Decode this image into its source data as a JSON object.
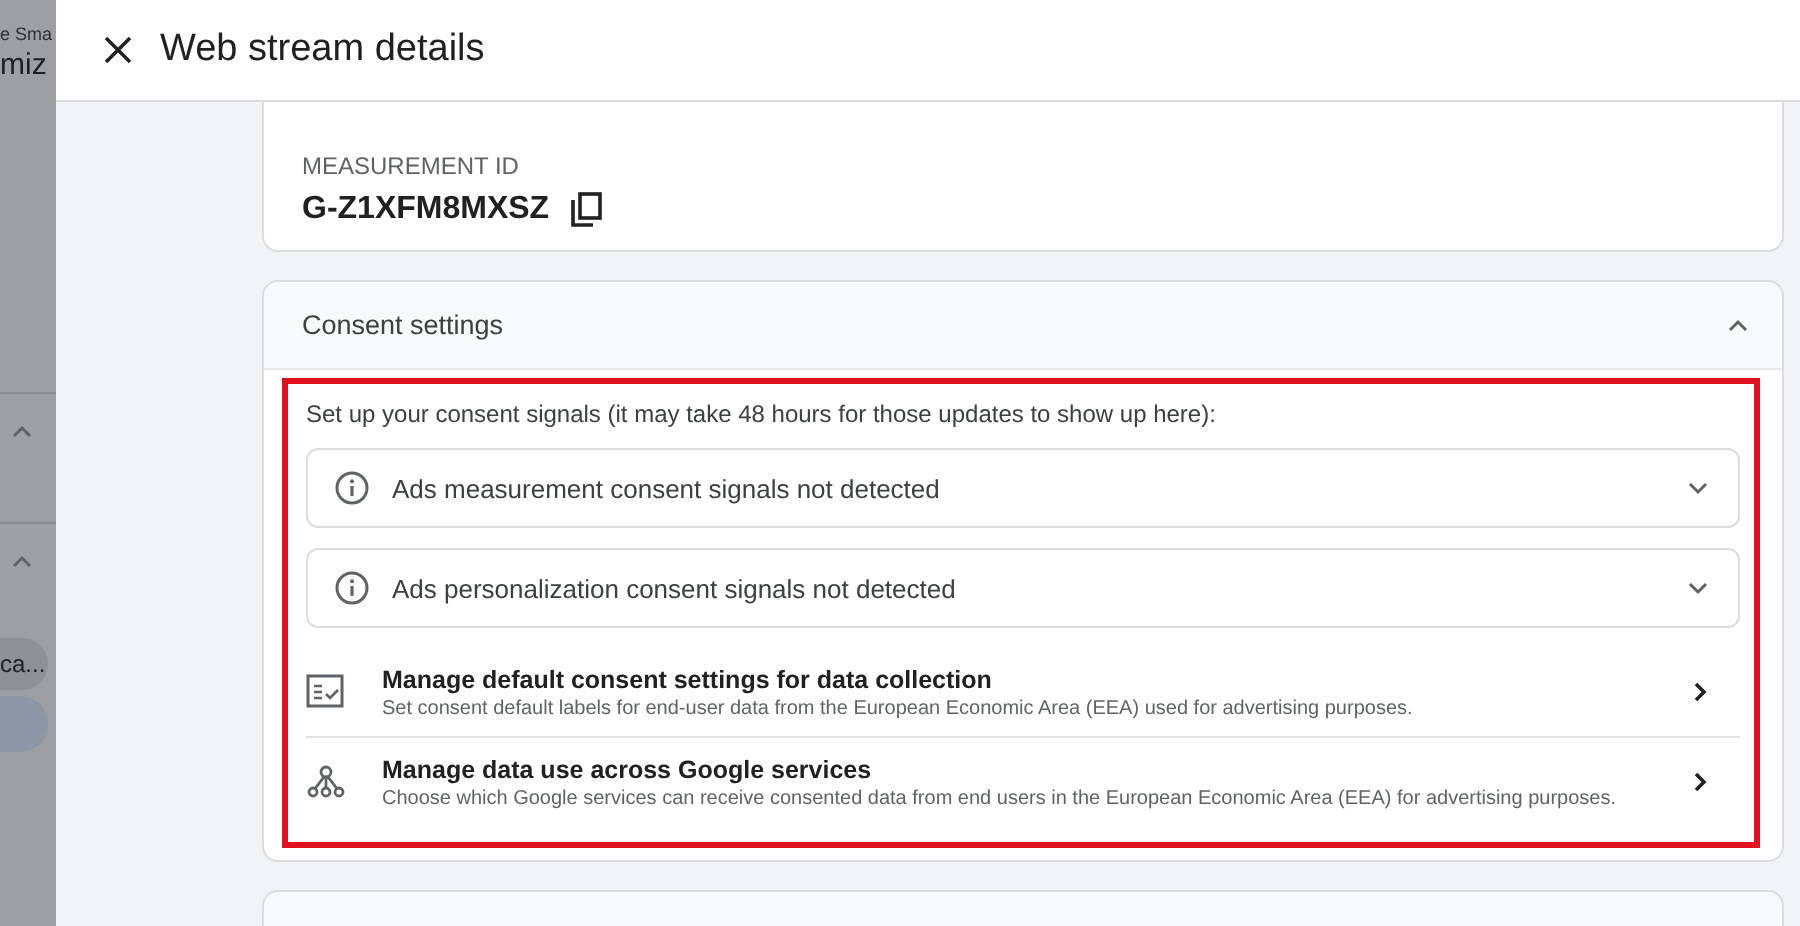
{
  "background_page": {
    "texts": [
      "e Sma",
      "miz",
      "ca..."
    ],
    "sections": [
      {
        "expanded": true
      },
      {
        "expanded": true
      }
    ]
  },
  "panel": {
    "title": "Web stream details"
  },
  "measurement": {
    "label": "MEASUREMENT ID",
    "value": "G-Z1XFM8MXSZ"
  },
  "consent": {
    "title": "Consent settings",
    "expanded": true,
    "highlighted": true,
    "intro": "Set up your consent signals (it may take 48 hours for those updates to show up here):",
    "signals": [
      {
        "label": "Ads measurement consent signals not detected",
        "expanded": false
      },
      {
        "label": "Ads personalization consent signals not detected",
        "expanded": false
      }
    ],
    "links": [
      {
        "kind": "checklist",
        "title": "Manage default consent settings for data collection",
        "description": "Set consent default labels for end-user data from the European Economic Area (EEA) used for advertising purposes."
      },
      {
        "kind": "share",
        "title": "Manage data use across Google services",
        "description": "Choose which Google services can receive consented data from end users in the European Economic Area (EEA) for advertising purposes."
      }
    ]
  }
}
